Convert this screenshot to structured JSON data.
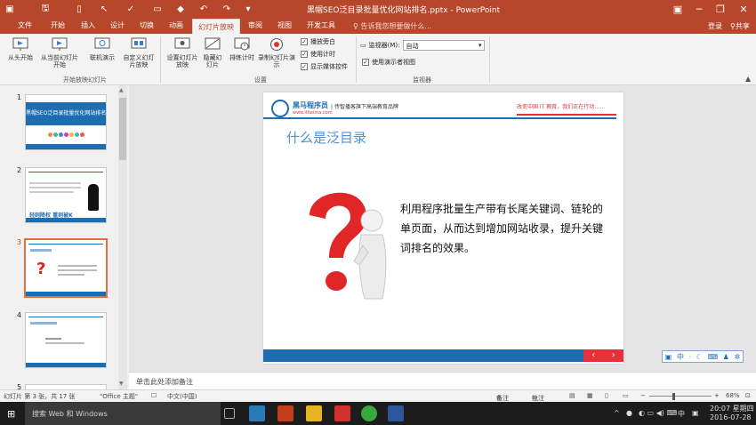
{
  "window": {
    "title": "黑帽SEO泛目录批量优化网站排名.pptx - PowerPoint"
  },
  "tabs": [
    {
      "label": "文件"
    },
    {
      "label": "开始"
    },
    {
      "label": "插入"
    },
    {
      "label": "设计"
    },
    {
      "label": "切换"
    },
    {
      "label": "动画"
    },
    {
      "label": "幻灯片放映"
    },
    {
      "label": "审阅"
    },
    {
      "label": "视图"
    },
    {
      "label": "开发工具"
    }
  ],
  "tell_me": "告诉我您想要做什么...",
  "account": {
    "login": "登录",
    "share": "共享"
  },
  "ribbon": {
    "group1": {
      "label": "开始放映幻灯片",
      "b1": "从头开始",
      "b2": "从当前幻灯片开始",
      "b3": "联机演示",
      "b4": "自定义幻灯片放映"
    },
    "group2": {
      "label": "设置",
      "b1": "设置幻灯片放映",
      "b2": "隐藏幻灯片",
      "b3": "排练计时",
      "b4": "录制幻灯片演示",
      "c1": "播放旁白",
      "c2": "使用计时",
      "c3": "显示媒体控件"
    },
    "group3": {
      "label": "监视器",
      "monitor_label": "监视器(M):",
      "monitor_value": "自动",
      "presenter_view": "使用演示者视图"
    }
  },
  "thumbs": [
    {
      "num": "1",
      "title": "黑帽SEO泛目录批量优化网站排名"
    },
    {
      "num": "2",
      "caption": "轻则降权 重则被K"
    },
    {
      "num": "3"
    },
    {
      "num": "4"
    },
    {
      "num": "5"
    }
  ],
  "slide": {
    "brand": "黑马程序员",
    "brand_url": "www.itheima.com",
    "tagline": "传智播客旗下高端教育品牌",
    "slogan": "改变中国 IT 教育，我们正在行动……",
    "heading": "什么是泛目录",
    "body": "利用程序批量生产带有长尾关键词、链轮的单页面，从而达到增加网站收录，提升关键词排名的效果。"
  },
  "notes_placeholder": "单击此处添加备注",
  "status": {
    "slide_info": "幻灯片 第 3 张，共 17 张",
    "theme": "\"Office 主题\"",
    "language": "中文(中国)",
    "notes": "备注",
    "comments": "批注",
    "zoom": "68%"
  },
  "taskbar": {
    "search": "搜索 Web 和 Windows",
    "time": "20:07",
    "day": "星期四",
    "date": "2016-07-28",
    "ime": "中"
  },
  "colors": {
    "accent": "#b7472a",
    "slide_blue": "#1f6db1",
    "slide_red": "#e8303a"
  }
}
